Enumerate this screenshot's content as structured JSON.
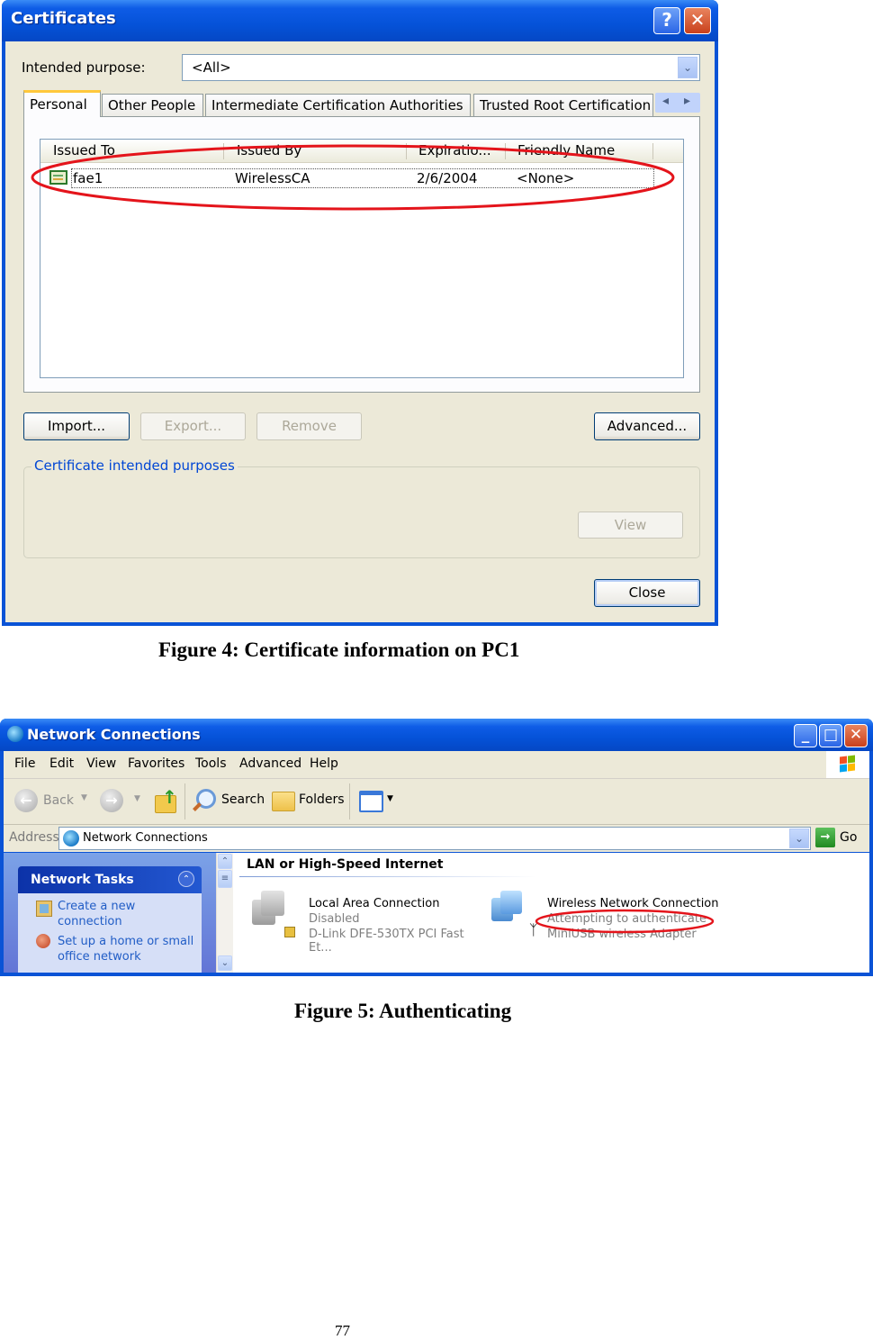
{
  "figure4": {
    "window": {
      "title": "Certificates",
      "help_button": "?",
      "close_button": "✕"
    },
    "intended_purpose": {
      "label": "Intended purpose:",
      "value": "<All>"
    },
    "tabs": [
      {
        "label": "Personal",
        "active": true
      },
      {
        "label": "Other People",
        "active": false
      },
      {
        "label": "Intermediate Certification Authorities",
        "active": false
      },
      {
        "label": "Trusted Root Certification",
        "active": false
      }
    ],
    "tab_scroll": {
      "left": "◂",
      "right": "▸"
    },
    "list": {
      "columns": [
        "Issued To",
        "Issued By",
        "Expiratio...",
        "Friendly Name"
      ],
      "rows": [
        {
          "issued_to": "fae1",
          "issued_by": "WirelessCA",
          "expiration": "2/6/2004",
          "friendly_name": "<None>",
          "icon": "certificate-icon",
          "highlighted": true
        }
      ]
    },
    "buttons": {
      "import": "Import...",
      "export": "Export...",
      "remove": "Remove",
      "advanced": "Advanced...",
      "view": "View",
      "close": "Close"
    },
    "group": {
      "title": "Certificate intended purposes"
    },
    "annotation_color": "#e4141b",
    "caption": "Figure 4: Certificate information on PC1"
  },
  "figure5": {
    "window": {
      "title": "Network Connections",
      "minimize": "_",
      "maximize": "□",
      "close": "✕"
    },
    "menu": [
      "File",
      "Edit",
      "View",
      "Favorites",
      "Tools",
      "Advanced",
      "Help"
    ],
    "toolbar": {
      "back": "Back",
      "search": "Search",
      "folders": "Folders"
    },
    "address": {
      "label": "Address",
      "value": "Network Connections",
      "go": "Go"
    },
    "task_pane": {
      "title": "Network Tasks",
      "items": [
        {
          "label": "Create a new connection",
          "line1": "Create a new",
          "line2": "connection"
        },
        {
          "label": "Set up a home or small office network",
          "line1": "Set up a home or small",
          "line2": "office network"
        }
      ]
    },
    "section_title": "LAN or High-Speed Internet",
    "connections": [
      {
        "name": "Local Area Connection",
        "status": "Disabled",
        "device": "D-Link DFE-530TX PCI Fast Et..."
      },
      {
        "name": "Wireless Network Connection",
        "status": "Attempting to authenticate",
        "device": "MiniUSB wireless Adapter",
        "highlighted": true
      }
    ],
    "caption": "Figure 5: Authenticating"
  },
  "page_number": "77"
}
